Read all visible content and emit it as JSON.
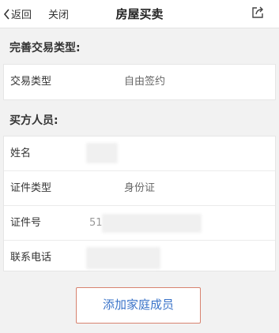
{
  "header": {
    "back_label": "返回",
    "close_label": "关闭",
    "title": "房屋买卖"
  },
  "trade_section": {
    "title": "完善交易类型:",
    "trade_type_label": "交易类型",
    "trade_type_value": "自由签约"
  },
  "buyer_section": {
    "title": "买方人员:",
    "name_label": "姓名",
    "id_type_label": "证件类型",
    "id_type_value": "身份证",
    "id_number_label": "证件号",
    "id_number_prefix": "51",
    "phone_label": "联系电话"
  },
  "add_family_button_label": "添加家庭成员",
  "colors": {
    "background": "#f2f2f2",
    "button_border": "#d7826f",
    "button_text": "#3b74c9"
  }
}
